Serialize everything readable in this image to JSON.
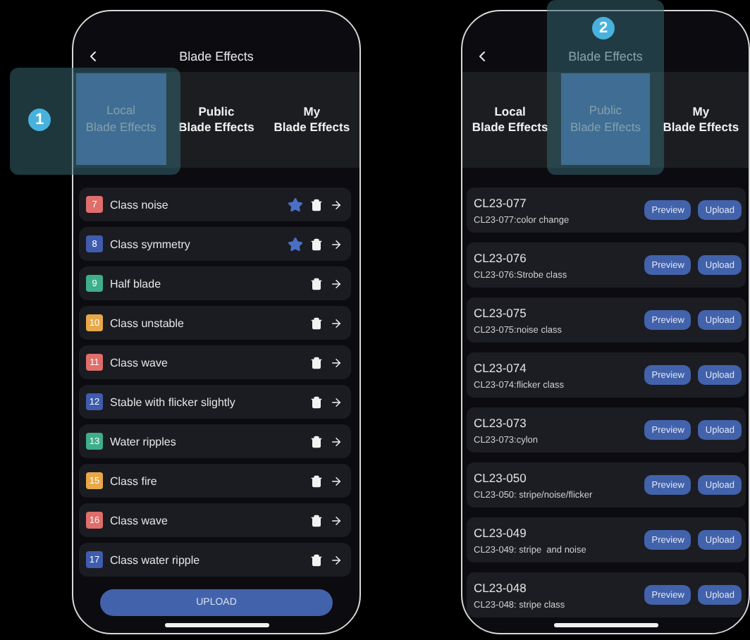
{
  "phones": [
    {
      "kind": "local",
      "title": "Blade Effects",
      "tabs": [
        {
          "label": "Local\nBlade Effects",
          "selected": true
        },
        {
          "label": "Public\nBlade Effects",
          "selected": false
        },
        {
          "label": "My\nBlade Effects",
          "selected": false
        }
      ],
      "effects": [
        {
          "number": "7",
          "name": "Class noise",
          "color": "#e06e6a",
          "starred": true
        },
        {
          "number": "8",
          "name": "Class symmetry",
          "color": "#3f5cae",
          "starred": true
        },
        {
          "number": "9",
          "name": "Half blade",
          "color": "#3fae8a",
          "starred": false
        },
        {
          "number": "10",
          "name": "Class unstable",
          "color": "#e8a848",
          "starred": false
        },
        {
          "number": "11",
          "name": "Class wave",
          "color": "#e06e6a",
          "starred": false
        },
        {
          "number": "12",
          "name": "Stable with flicker slightly",
          "color": "#3f5cae",
          "starred": false
        },
        {
          "number": "13",
          "name": "Water ripples",
          "color": "#3fae8a",
          "starred": false
        },
        {
          "number": "15",
          "name": "Class fire",
          "color": "#e8a848",
          "starred": false
        },
        {
          "number": "16",
          "name": "Class wave",
          "color": "#e06e6a",
          "starred": false
        },
        {
          "number": "17",
          "name": "Class water ripple",
          "color": "#3f5cae",
          "starred": false
        }
      ],
      "upload_button": "UPLOAD"
    },
    {
      "kind": "public",
      "title": "Blade Effects",
      "tabs": [
        {
          "label": "Local\nBlade Effects",
          "selected": false
        },
        {
          "label": "Public\nBlade Effects",
          "selected": true
        },
        {
          "label": "My\nBlade Effects",
          "selected": false
        }
      ],
      "cards": [
        {
          "title": "CL23-077",
          "description": "CL23-077:color change",
          "buttons": [
            "Preview",
            "Upload"
          ]
        },
        {
          "title": "CL23-076",
          "description": "CL23-076:Strobe class",
          "buttons": [
            "Preview",
            "Upload"
          ]
        },
        {
          "title": "CL23-075",
          "description": "CL23-075:noise class",
          "buttons": [
            "Preview",
            "Upload"
          ]
        },
        {
          "title": "CL23-074",
          "description": "CL23-074:flicker class",
          "buttons": [
            "Preview",
            "Upload"
          ]
        },
        {
          "title": "CL23-073",
          "description": "CL23-073:cylon",
          "buttons": [
            "Preview",
            "Upload"
          ]
        },
        {
          "title": "CL23-050",
          "description": "CL23-050: stripe/noise/flicker",
          "buttons": [
            "Preview",
            "Upload"
          ]
        },
        {
          "title": "CL23-049",
          "description": "CL23-049: stripe  and noise",
          "buttons": [
            "Preview",
            "Upload"
          ]
        },
        {
          "title": "CL23-048",
          "description": "CL23-048: stripe class",
          "buttons": [
            "Preview",
            "Upload"
          ]
        }
      ]
    }
  ],
  "callouts": [
    {
      "label": "1"
    },
    {
      "label": "2"
    }
  ]
}
